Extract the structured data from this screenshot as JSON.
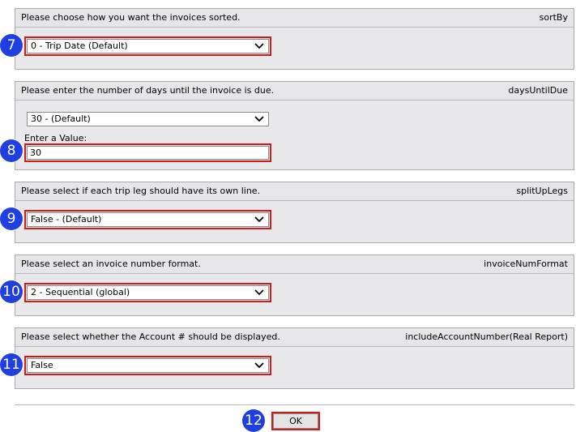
{
  "panels": [
    {
      "prompt": "Please choose how you want the invoices sorted.",
      "param": "sortBy",
      "select_value": "0 - Trip Date (Default)",
      "step": "7"
    },
    {
      "prompt": "Please enter the number of days until the invoice is due.",
      "param": "daysUntilDue",
      "select_value": "30 - (Default)",
      "input_label": "Enter a Value:",
      "input_value": "30",
      "step": "8"
    },
    {
      "prompt": "Please select if each trip leg should have its own line.",
      "param": "splitUpLegs",
      "select_value": "False - (Default)",
      "step": "9"
    },
    {
      "prompt": "Please select an invoice number format.",
      "param": "invoiceNumFormat",
      "select_value": "2 - Sequential (global)",
      "step": "10"
    },
    {
      "prompt": "Please select whether the Account # should be displayed.",
      "param": "includeAccountNumber(Real Report)",
      "select_value": "False",
      "step": "11"
    }
  ],
  "ok_button": {
    "label": "OK",
    "step": "12"
  },
  "colors": {
    "badge": "#1f3fe0",
    "highlight": "#d11a1a",
    "panel_bg": "#e8e8eb"
  },
  "icons": {
    "dropdown": "chevron-down-icon"
  }
}
